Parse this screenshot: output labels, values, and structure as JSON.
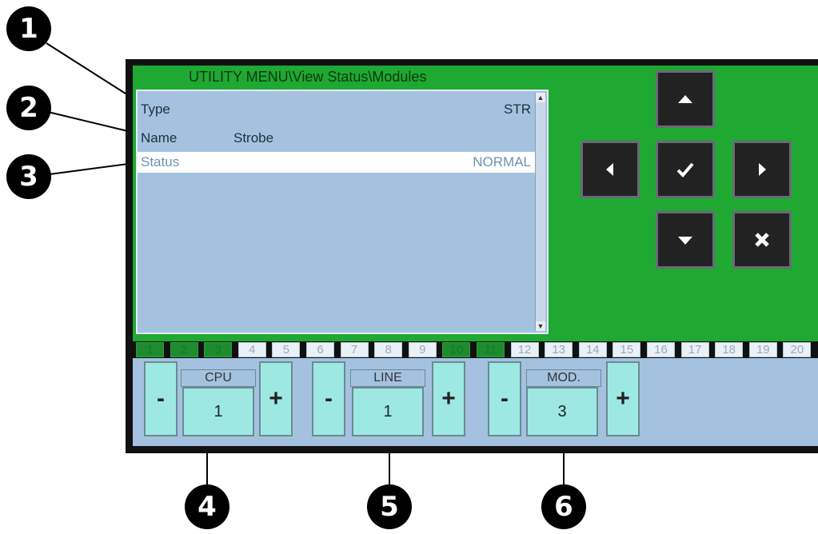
{
  "callouts": [
    "1",
    "2",
    "3",
    "4",
    "5",
    "6"
  ],
  "header": {
    "title": "UTILITY MENU\\View Status\\Modules"
  },
  "list": {
    "rows": [
      {
        "label": "Type",
        "value": "STR"
      },
      {
        "label": "Name",
        "value": "Strobe"
      },
      {
        "label": "Status",
        "value": "NORMAL"
      }
    ]
  },
  "nav": {
    "up": "arrow-up-icon",
    "left": "arrow-left-icon",
    "ok": "check-icon",
    "right": "arrow-right-icon",
    "down": "arrow-down-icon",
    "cancel": "cancel-icon"
  },
  "tabs": [
    "1",
    "2",
    "3",
    "4",
    "5",
    "6",
    "7",
    "8",
    "9",
    "10",
    "11",
    "12",
    "13",
    "14",
    "15",
    "16",
    "17",
    "18",
    "19",
    "20"
  ],
  "controls": {
    "minus": "-",
    "plus": "+",
    "cpu": {
      "label": "CPU",
      "value": "1"
    },
    "line": {
      "label": "LINE",
      "value": "1"
    },
    "mod": {
      "label": "MOD.",
      "value": "3"
    }
  },
  "colors": {
    "panel": "#1fa832",
    "list": "#a4c2e0",
    "buttons": "#9ee8e4",
    "active_tab": "#1f8a30"
  }
}
